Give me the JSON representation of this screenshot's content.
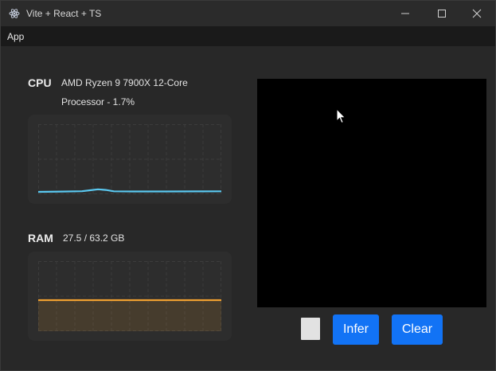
{
  "window": {
    "title": "Vite + React + TS"
  },
  "menu": {
    "items": [
      "App"
    ]
  },
  "cpu": {
    "label": "CPU",
    "description_line1": "AMD Ryzen 9 7900X 12-Core",
    "description_line2": "Processor - 1.7%",
    "usage_percent": 1.7,
    "line_color": "#5ac8f0"
  },
  "ram": {
    "label": "RAM",
    "description": "27.5 / 63.2 GB",
    "used_gb": 27.5,
    "total_gb": 63.2,
    "line_color": "#f0a030"
  },
  "controls": {
    "infer_label": "Infer",
    "clear_label": "Clear",
    "brush_color": "#e2e2e2",
    "button_color": "#1273f5"
  },
  "icons": {
    "app": "electron-icon",
    "minimize": "minimize-icon",
    "maximize": "maximize-icon",
    "close": "close-icon",
    "cursor": "cursor-icon"
  }
}
